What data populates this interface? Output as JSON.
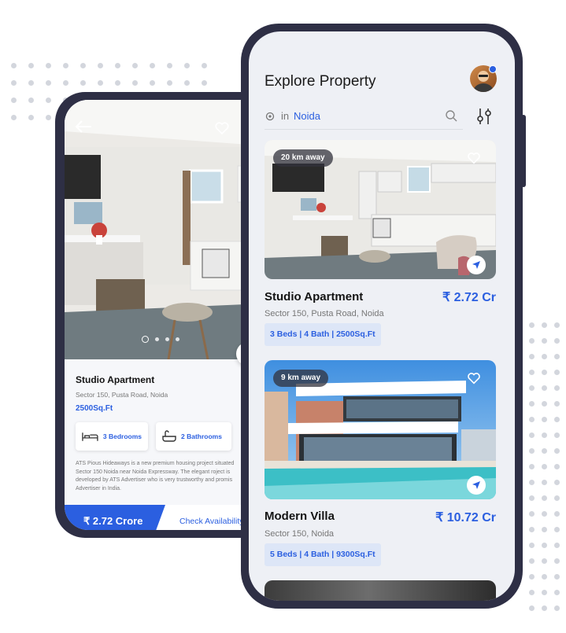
{
  "back_screen": {
    "title": "Studio Apartment",
    "address": "Sector 150, Pusta Road, Noida",
    "area": "2500Sq.Ft",
    "features": [
      {
        "label": "3 Bedrooms",
        "icon": "bed-icon"
      },
      {
        "label": "2 Bathrooms",
        "icon": "bathtub-icon"
      }
    ],
    "description": "ATS Pious Hideaways is a new premium housing project situated Sector 150 Noida near Noida Expressway. The elegant roject is developed by ATS Advertiser who is very trustworthy and promis Advertiser in India.",
    "price": "₹ 2.72 Crore",
    "check_availability": "Check Availability",
    "image_pager": {
      "count": 4,
      "active": 0
    }
  },
  "front_screen": {
    "title": "Explore Property",
    "location_prefix": "in",
    "location_city": "Noida",
    "listings": [
      {
        "badge": "20 km away",
        "name": "Studio Apartment",
        "price": "₹ 2.72 Cr",
        "address": "Sector 150, Pusta Road, Noida",
        "specs": "3 Beds | 4 Bath | 2500Sq.Ft"
      },
      {
        "badge": "9 km away",
        "name": "Modern Villa",
        "price": "₹ 10.72 Cr",
        "address": "Sector 150, Noida",
        "specs": "5 Beds | 4 Bath | 9300Sq.Ft"
      }
    ]
  },
  "colors": {
    "accent": "#2b5fe0",
    "phone_frame": "#2e2f45",
    "spec_background": "#dde6f7"
  }
}
